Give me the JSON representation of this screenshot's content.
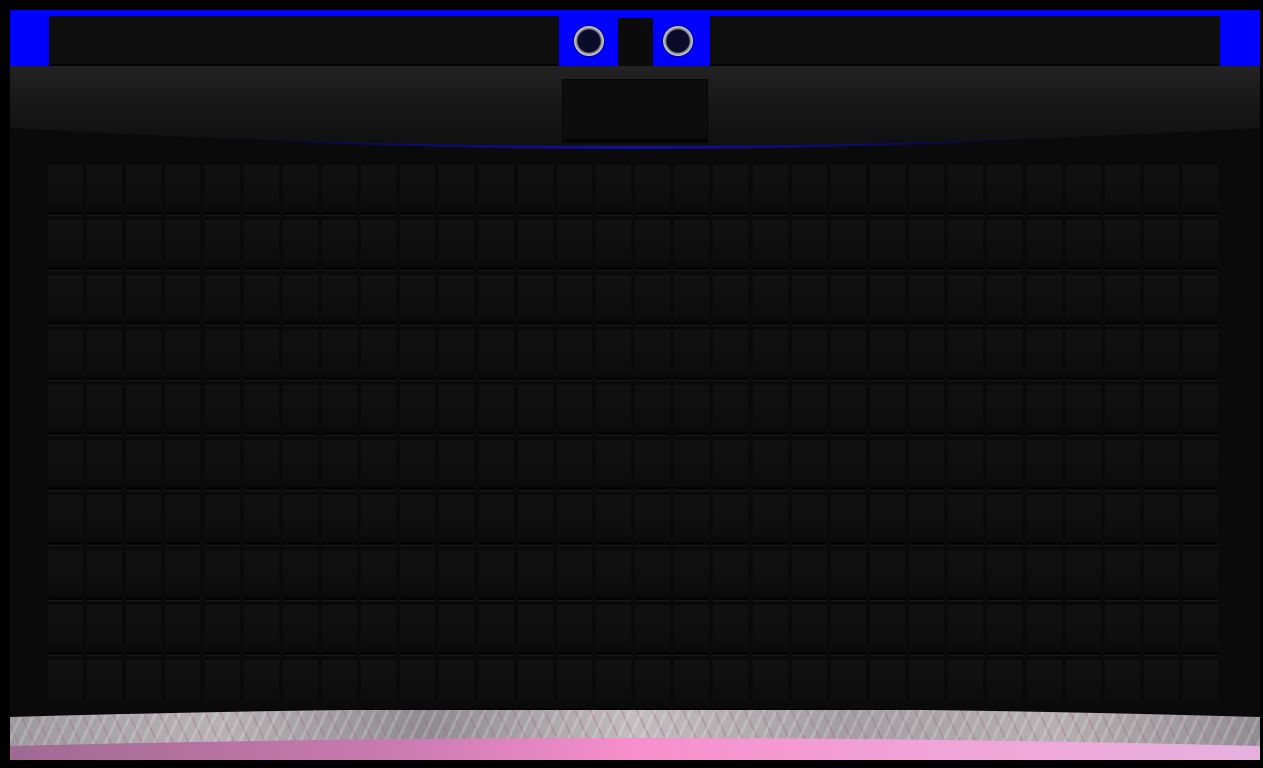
{
  "board": {
    "rows": 10,
    "columns": 30
  },
  "colors": {
    "accent": "#0000ff",
    "panel": "#0e0e0e",
    "background": "#0a0a0a",
    "floor_gradient": [
      "#a06a93",
      "#f68fcb",
      "#e6b0de"
    ]
  },
  "icons": {
    "left_knob": "ring-button-icon",
    "right_knob": "ring-button-icon"
  }
}
